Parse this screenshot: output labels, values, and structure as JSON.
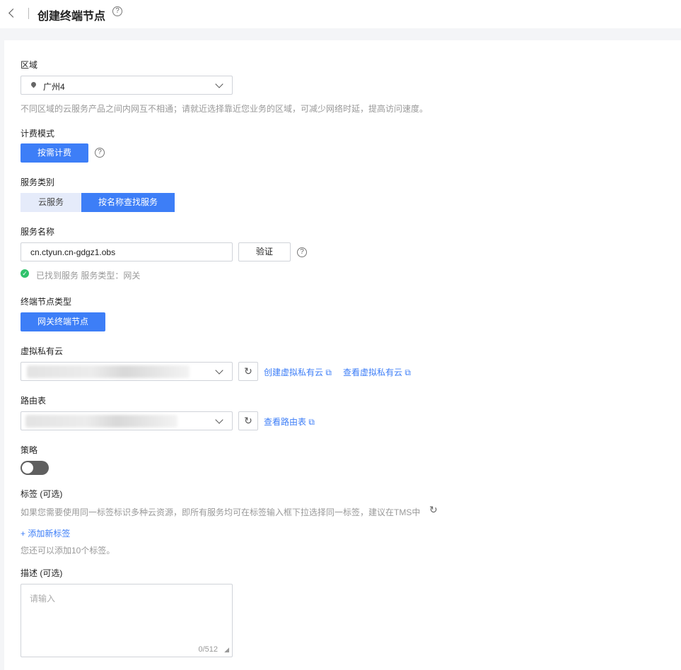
{
  "header": {
    "title": "创建终端节点"
  },
  "region": {
    "label": "区域",
    "value": "广州4",
    "hint": "不同区域的云服务产品之间内网互不相通；请就近选择靠近您业务的区域，可减少网络时延，提高访问速度。"
  },
  "billing": {
    "label": "计费模式",
    "option": "按需计费"
  },
  "service_type": {
    "label": "服务类别",
    "options": [
      "云服务",
      "按名称查找服务"
    ]
  },
  "service_name": {
    "label": "服务名称",
    "value": "cn.ctyun.cn-gdgz1.obs",
    "verify": "验证",
    "status": "已找到服务 服务类型：网关"
  },
  "endpoint_type": {
    "label": "终端节点类型",
    "option": "网关终端节点"
  },
  "vpc": {
    "label": "虚拟私有云",
    "create_link": "创建虚拟私有云",
    "view_link": "查看虚拟私有云"
  },
  "route_table": {
    "label": "路由表",
    "view_link": "查看路由表"
  },
  "policy": {
    "label": "策略",
    "enabled": false
  },
  "tags": {
    "label": "标签 (可选)",
    "hint": "如果您需要使用同一标签标识多种云资源，即所有服务均可在标签输入框下拉选择同一标签，建议在TMS中",
    "add": "+ 添加新标签",
    "remaining": "您还可以添加10个标签。"
  },
  "description": {
    "label": "描述 (可选)",
    "placeholder": "请输入",
    "counter": "0/512"
  },
  "colors": {
    "primary": "#3d7ef7",
    "success": "#2fc26b"
  }
}
